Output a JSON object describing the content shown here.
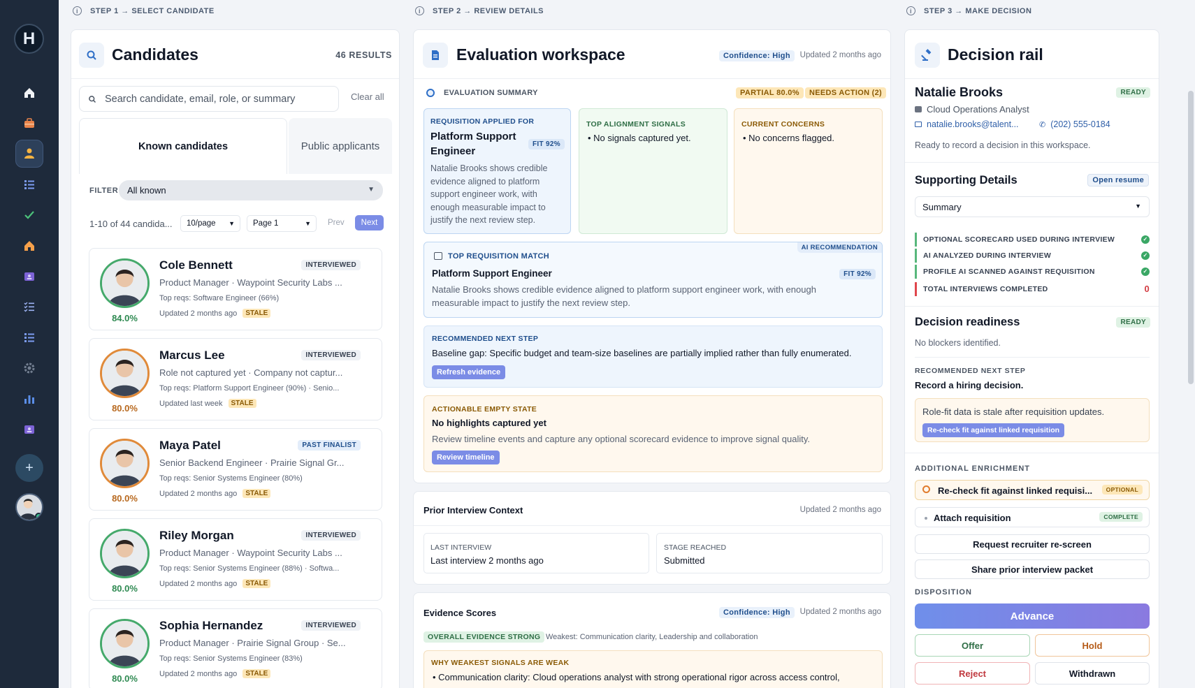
{
  "sidebar": {
    "logo": "H",
    "add_label": "+"
  },
  "steps": {
    "s1": "STEP 1 → SELECT CANDIDATE",
    "s2": "STEP 2 → REVIEW DETAILS",
    "s3": "STEP 3 → MAKE DECISION"
  },
  "candidates_panel": {
    "title": "Candidates",
    "results": "46 RESULTS",
    "search_placeholder": "Search candidate, email, role, or summary",
    "clear_label": "Clear all",
    "tabs": [
      "Known candidates",
      "Public applicants"
    ],
    "filter_label": "FILTER",
    "filter_value": "All known",
    "range_text": "1-10 of 44 candida...",
    "per_page": "10/page",
    "page": "Page 1",
    "prev": "Prev",
    "next": "Next",
    "list": [
      {
        "name": "Cole Bennett",
        "status": "INTERVIEWED",
        "role": "Product Manager · Waypoint Security Labs ...",
        "reqs": "Top reqs: Software Engineer (66%)",
        "updated": "Updated 2 months ago",
        "stale": "STALE",
        "score": "84.0%",
        "score_color": "#2f8a52"
      },
      {
        "name": "Marcus Lee",
        "status": "INTERVIEWED",
        "role": "Role not captured yet · Company not captur...",
        "reqs": "Top reqs: Platform Support Engineer (90%) · Senio...",
        "updated": "Updated last week",
        "stale": "STALE",
        "score": "80.0%",
        "score_color": "#b8691f"
      },
      {
        "name": "Maya Patel",
        "status": "PAST FINALIST",
        "role": "Senior Backend Engineer · Prairie Signal Gr...",
        "reqs": "Top reqs: Senior Systems Engineer (80%)",
        "updated": "Updated 2 months ago",
        "stale": "STALE",
        "score": "80.0%",
        "score_color": "#b8691f"
      },
      {
        "name": "Riley Morgan",
        "status": "INTERVIEWED",
        "role": "Product Manager · Waypoint Security Labs ...",
        "reqs": "Top reqs: Senior Systems Engineer (88%) · Softwa...",
        "updated": "Updated 2 months ago",
        "stale": "STALE",
        "score": "80.0%",
        "score_color": "#2f8a52"
      },
      {
        "name": "Sophia Hernandez",
        "status": "INTERVIEWED",
        "role": "Product Manager · Prairie Signal Group · Se...",
        "reqs": "Top reqs: Senior Systems Engineer (83%)",
        "updated": "Updated 2 months ago",
        "stale": "STALE",
        "score": "80.0%",
        "score_color": "#2f8a52"
      }
    ]
  },
  "workspace": {
    "title": "Evaluation workspace",
    "confidence": "Confidence: High",
    "updated": "Updated 2 months ago",
    "summary_label": "EVALUATION SUMMARY",
    "partial": "PARTIAL 80.0%",
    "needs_action": "NEEDS ACTION (2)",
    "req_label": "REQUISITION APPLIED FOR",
    "req_title": "Platform Support Engineer",
    "req_fit": "FIT 92%",
    "req_desc": "Natalie Brooks shows credible evidence aligned to platform support engineer work, with enough measurable impact to justify the next review step.",
    "signals_label": "TOP ALIGNMENT SIGNALS",
    "signals_item": "No signals captured yet.",
    "concerns_label": "CURRENT CONCERNS",
    "concerns_item": "No concerns flagged.",
    "match_label": "TOP REQUISITION MATCH",
    "ai_rec": "AI RECOMMENDATION",
    "match_title": "Platform Support Engineer",
    "match_fit": "FIT 92%",
    "match_desc": "Natalie Brooks shows credible evidence aligned to platform support engineer work, with enough measurable impact to justify the next review step.",
    "next_label": "RECOMMENDED NEXT STEP",
    "next_text": "Baseline gap: Specific budget and team-size baselines are partially implied rather than fully enumerated.",
    "refresh_btn": "Refresh evidence",
    "empty_label": "ACTIONABLE EMPTY STATE",
    "empty_title": "No highlights captured yet",
    "empty_desc": "Review timeline events and capture any optional scorecard evidence to improve signal quality.",
    "timeline_btn": "Review timeline"
  },
  "prior": {
    "title": "Prior Interview Context",
    "updated": "Updated 2 months ago",
    "last_label": "LAST INTERVIEW",
    "last_value": "Last interview 2 months ago",
    "stage_label": "STAGE REACHED",
    "stage_value": "Submitted"
  },
  "evidence": {
    "title": "Evidence Scores",
    "confidence": "Confidence: High",
    "updated": "Updated 2 months ago",
    "overall": "OVERALL EVIDENCE STRONG",
    "weakest": "Weakest: Communication clarity, Leadership and collaboration",
    "why_label": "WHY WEAKEST SIGNALS ARE WEAK",
    "why_item": "Communication clarity: Cloud operations analyst with strong operational rigor across access control,"
  },
  "decision": {
    "title": "Decision rail",
    "name": "Natalie Brooks",
    "ready": "READY",
    "role": "Cloud Operations Analyst",
    "email": "natalie.brooks@talent...",
    "phone": "(202) 555-0184",
    "ready_text": "Ready to record a decision in this workspace.",
    "supporting_title": "Supporting Details",
    "open_resume": "Open resume",
    "summary_select": "Summary",
    "checks": [
      "OPTIONAL SCORECARD USED DURING INTERVIEW",
      "AI ANALYZED DURING INTERVIEW",
      "PROFILE AI SCANNED AGAINST REQUISITION"
    ],
    "total_label": "TOTAL INTERVIEWS COMPLETED",
    "total_value": "0",
    "readiness_title": "Decision readiness",
    "readiness_badge": "READY",
    "blockers": "No blockers identified.",
    "rec_label": "RECOMMENDED NEXT STEP",
    "rec_text": "Record a hiring decision.",
    "stale_note": "Role-fit data is stale after requisition updates.",
    "recheck_btn": "Re-check fit against linked requisition",
    "enrich_label": "ADDITIONAL ENRICHMENT",
    "enrich_1": "Re-check fit against linked requisi...",
    "enrich_1_badge": "OPTIONAL",
    "enrich_2": "Attach requisition",
    "enrich_2_badge": "COMPLETE",
    "rescreen": "Request recruiter re-screen",
    "share": "Share prior interview packet",
    "disposition_label": "DISPOSITION",
    "advance": "Advance",
    "offer": "Offer",
    "hold": "Hold",
    "reject": "Reject",
    "withdrawn": "Withdrawn"
  },
  "colors": {
    "accent": "#7b8ce6",
    "sidebar": "#1e2a3b",
    "ready": "#2f8a52"
  }
}
